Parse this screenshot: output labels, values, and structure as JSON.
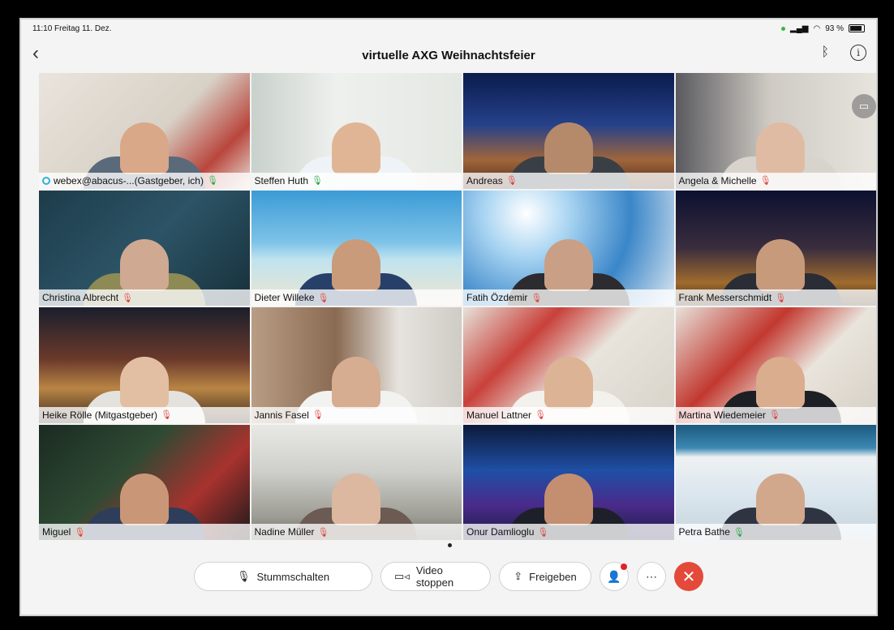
{
  "status": {
    "time_date": "11:10  Freitag 11. Dez.",
    "battery": "93 %"
  },
  "header": {
    "title": "virtuelle AXG Weihnachtsfeier"
  },
  "participants": [
    {
      "name": "webex@abacus-...(Gastgeber, ich)",
      "mic": "on",
      "host": true
    },
    {
      "name": "Steffen Huth",
      "mic": "on"
    },
    {
      "name": "Andreas",
      "mic": "off"
    },
    {
      "name": "Angela & Michelle",
      "mic": "off"
    },
    {
      "name": "Christina Albrecht",
      "mic": "off"
    },
    {
      "name": "Dieter Willeke",
      "mic": "off"
    },
    {
      "name": "Fatih Özdemir",
      "mic": "off"
    },
    {
      "name": "Frank Messerschmidt",
      "mic": "off"
    },
    {
      "name": "Heike Rölle (Mitgastgeber)",
      "mic": "off"
    },
    {
      "name": "Jannis Fasel",
      "mic": "off"
    },
    {
      "name": "Manuel Lattner",
      "mic": "off"
    },
    {
      "name": "Martina Wiedemeier",
      "mic": "off"
    },
    {
      "name": "Miguel",
      "mic": "off"
    },
    {
      "name": "Nadine Müller",
      "mic": "off"
    },
    {
      "name": "Onur Damlioglu",
      "mic": "off"
    },
    {
      "name": "Petra Bathe",
      "mic": "on"
    }
  ],
  "controls": {
    "mute_label": "Stummschalten",
    "video_label": "Video stoppen",
    "share_label": "Freigeben"
  },
  "colors": {
    "accent": "#2bb3d9",
    "end_call": "#e34a3a",
    "mic_on": "#2aa84a",
    "mic_off": "#e0413a"
  }
}
